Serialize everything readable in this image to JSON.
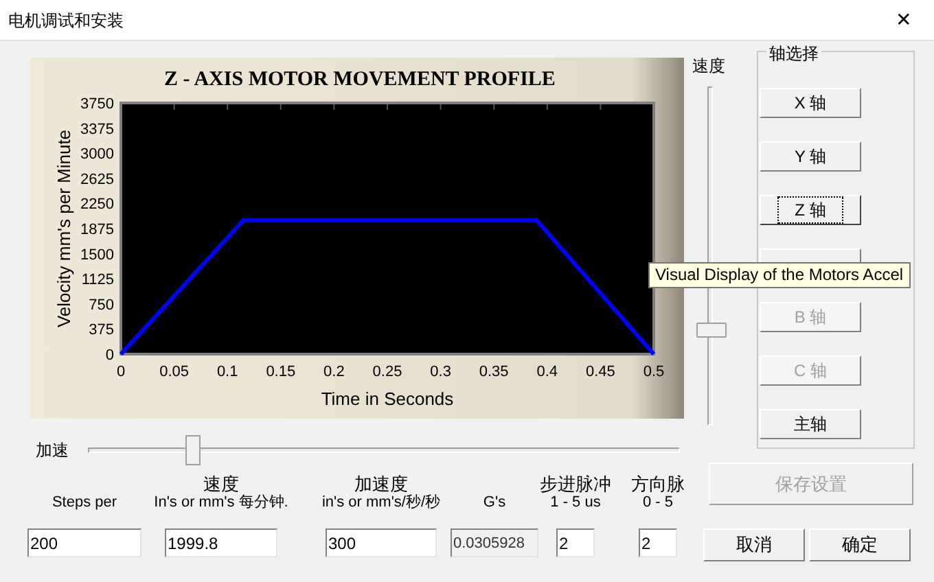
{
  "window": {
    "title": "电机调试和安装",
    "close": "✕"
  },
  "chart": {
    "chart_data": {
      "type": "line",
      "title": "Z - AXIS MOTOR MOVEMENT PROFILE",
      "xlabel": "Time in Seconds",
      "ylabel": "Velocity mm's per Minute",
      "x": [
        0,
        0.115,
        0.39,
        0.5
      ],
      "series": [
        {
          "color": "#0000ff",
          "values": [
            0,
            2000,
            2000,
            0
          ]
        }
      ],
      "xlim": [
        0,
        0.5
      ],
      "ylim": [
        0,
        3750
      ],
      "xticks": [
        {
          "value": 0,
          "label": "0"
        },
        {
          "value": 0.05,
          "label": "0.05"
        },
        {
          "value": 0.1,
          "label": "0.1"
        },
        {
          "value": 0.15,
          "label": "0.15"
        },
        {
          "value": 0.2,
          "label": "0.2"
        },
        {
          "value": 0.25,
          "label": "0.25"
        },
        {
          "value": 0.3,
          "label": "0.3"
        },
        {
          "value": 0.35,
          "label": "0.35"
        },
        {
          "value": 0.4,
          "label": "0.4"
        },
        {
          "value": 0.45,
          "label": "0.45"
        },
        {
          "value": 0.5,
          "label": "0.5"
        }
      ],
      "yticks": [
        0,
        375,
        750,
        1125,
        1500,
        1875,
        2250,
        2625,
        3000,
        3375,
        3750
      ]
    }
  },
  "speed_slider": {
    "label": "速度",
    "level": 0.27
  },
  "axis_group": {
    "title": "轴选择",
    "buttons": [
      {
        "label": "X 轴",
        "selected": false,
        "disabled": false
      },
      {
        "label": "Y 轴",
        "selected": false,
        "disabled": false
      },
      {
        "label": "Z 轴",
        "selected": true,
        "disabled": false
      },
      {
        "selected": false
      },
      {
        "label": "B 轴",
        "selected": false,
        "disabled": true
      },
      {
        "label": "C 轴",
        "selected": false,
        "disabled": true
      },
      {
        "label": "主轴",
        "selected": false,
        "disabled": false
      }
    ]
  },
  "tooltip": "Visual Display of the Motors Accel",
  "accel_slider": {
    "label": "加速",
    "level": 0.17
  },
  "fields": [
    {
      "title_lines": [
        "Steps per"
      ],
      "value": "200",
      "readonly": false
    },
    {
      "title_lines": [
        "速度",
        "In's or mm's 每分钟."
      ],
      "value": "1999.8",
      "readonly": false
    },
    {
      "title_lines": [
        "加速度",
        "in's or mm's/秒/秒"
      ],
      "value": "300",
      "readonly": false
    },
    {
      "title_lines": [
        "G's"
      ],
      "value": "0.0305928",
      "readonly": true
    },
    {
      "title_lines": [
        "步进脉冲",
        "1 - 5 us"
      ],
      "value": "2",
      "readonly": false
    },
    {
      "title_lines": [
        "方向脉",
        "0 - 5"
      ],
      "value": "2",
      "readonly": false
    }
  ],
  "save_button": {
    "label": "保存设置",
    "disabled": true
  },
  "buttons": [
    "取消",
    "确定"
  ]
}
